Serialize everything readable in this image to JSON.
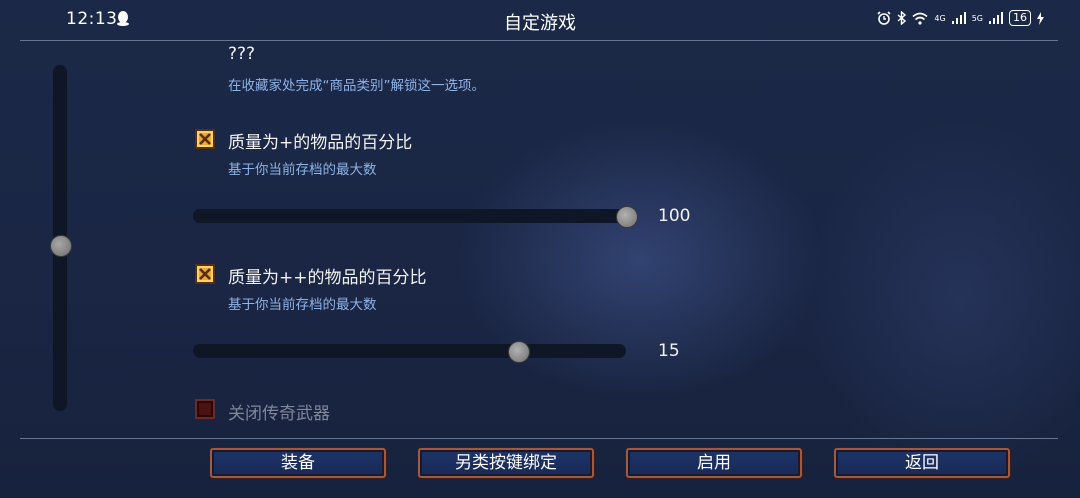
{
  "status_bar": {
    "time": "12:13",
    "battery": "16",
    "network_labels": [
      "4G",
      "5G"
    ]
  },
  "header": {
    "title": "自定游戏"
  },
  "options": [
    {
      "title": "???",
      "description": "在收藏家处完成“商品类别”解锁这一选项。"
    },
    {
      "title": "质量为+的物品的百分比",
      "description": "基于你当前存档的最大数",
      "checked": true,
      "slider_value": "100",
      "slider_fraction": 1.0
    },
    {
      "title": "质量为++的物品的百分比",
      "description": "基于你当前存档的最大数",
      "checked": true,
      "slider_value": "15",
      "slider_fraction": 0.75
    },
    {
      "title": "关闭传奇武器",
      "checked": false,
      "disabled": true
    }
  ],
  "buttons": {
    "equip": "装备",
    "alt_keybind": "另类按键绑定",
    "enable": "启用",
    "back": "返回"
  },
  "colors": {
    "background": "#1a2644",
    "accent_checkbox": "#e8a83a",
    "description_text": "#8fb3e6",
    "button_border": "#a05a42"
  }
}
